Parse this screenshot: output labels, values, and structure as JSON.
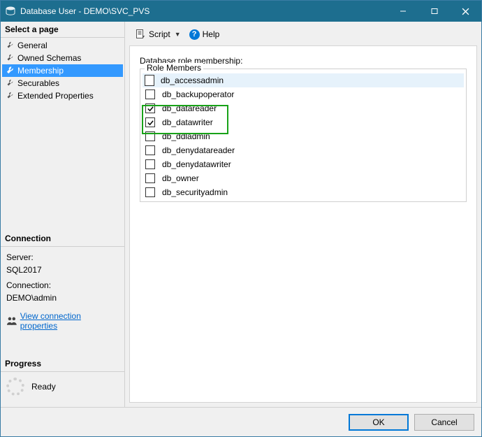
{
  "window": {
    "title": "Database User - DEMO\\SVC_PVS"
  },
  "sidebar": {
    "select_page_header": "Select a page",
    "pages": [
      {
        "label": "General"
      },
      {
        "label": "Owned Schemas"
      },
      {
        "label": "Membership"
      },
      {
        "label": "Securables"
      },
      {
        "label": "Extended Properties"
      }
    ],
    "connection_header": "Connection",
    "server_label": "Server:",
    "server_value": "SQL2017",
    "connection_label": "Connection:",
    "connection_value": "DEMO\\admin",
    "view_connection_label": "View connection properties",
    "progress_header": "Progress",
    "progress_status": "Ready"
  },
  "toolbar": {
    "script_label": "Script",
    "help_label": "Help"
  },
  "main": {
    "role_membership_label": "Database role membership:",
    "role_members_header": "Role Members",
    "roles": [
      {
        "name": "db_accessadmin",
        "checked": false
      },
      {
        "name": "db_backupoperator",
        "checked": false
      },
      {
        "name": "db_datareader",
        "checked": true
      },
      {
        "name": "db_datawriter",
        "checked": true
      },
      {
        "name": "db_ddladmin",
        "checked": false
      },
      {
        "name": "db_denydatareader",
        "checked": false
      },
      {
        "name": "db_denydatawriter",
        "checked": false
      },
      {
        "name": "db_owner",
        "checked": false
      },
      {
        "name": "db_securityadmin",
        "checked": false
      }
    ],
    "highlight_color": "#18a218"
  },
  "footer": {
    "ok_label": "OK",
    "cancel_label": "Cancel"
  }
}
